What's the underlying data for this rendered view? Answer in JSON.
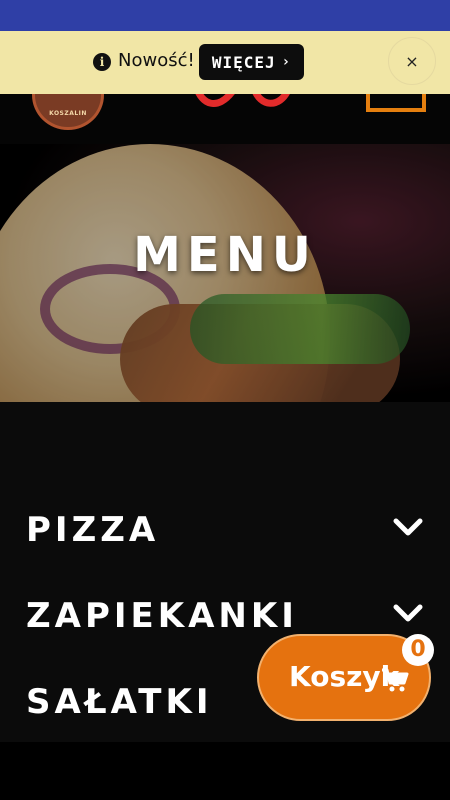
{
  "notice": {
    "text": "Nowość!",
    "more_label": "WIĘCEJ",
    "more_chevron": "›",
    "close_label": "×"
  },
  "header": {
    "logo_text": "KOSZALIN"
  },
  "hero": {
    "title": "MENU"
  },
  "menu": {
    "items": [
      {
        "label": "PIZZA"
      },
      {
        "label": "ZAPIEKANKI"
      },
      {
        "label": "SAŁATKI"
      }
    ]
  },
  "cart": {
    "label": "Koszyk",
    "count": "0"
  },
  "colors": {
    "status_bar": "#2f3fa6",
    "notice_bg": "#f1e6a6",
    "accent_orange": "#e5720f",
    "background": "#0b0b0b"
  },
  "icons": {
    "info": "info-icon",
    "close": "close-icon",
    "chevron_down": "chevron-down-icon",
    "cart": "shopping-cart-icon",
    "hamburger": "hamburger-menu-icon"
  }
}
